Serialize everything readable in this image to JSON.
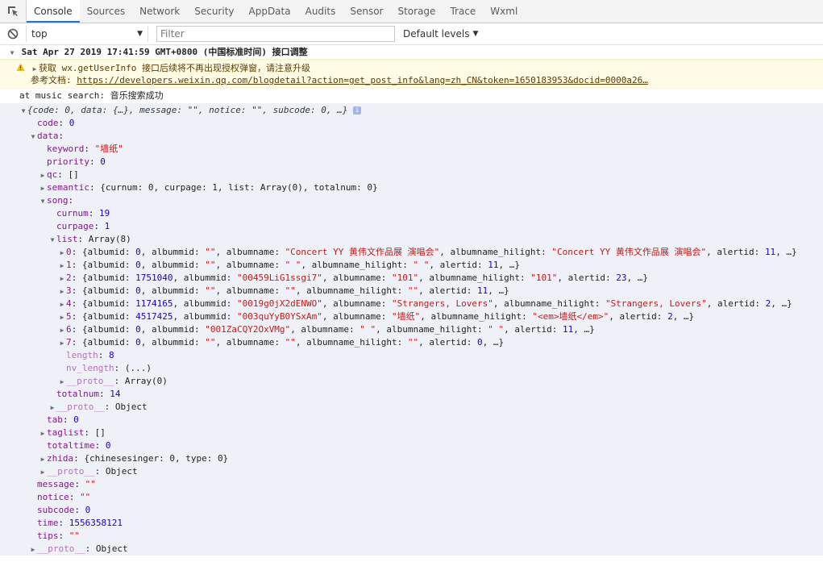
{
  "tabs": [
    {
      "label": "Console",
      "active": true
    },
    {
      "label": "Sources"
    },
    {
      "label": "Network"
    },
    {
      "label": "Security"
    },
    {
      "label": "AppData"
    },
    {
      "label": "Audits"
    },
    {
      "label": "Sensor"
    },
    {
      "label": "Storage"
    },
    {
      "label": "Trace"
    },
    {
      "label": "Wxml"
    }
  ],
  "toolbar": {
    "context": "top",
    "filter_placeholder": "Filter",
    "levels": "Default levels"
  },
  "group_header": "Sat Apr 27 2019 17:41:59 GMT+0800 (中国标准时间) 接口调整",
  "warning": {
    "prefix": "获取",
    "api": "wx.getUserInfo",
    "message": "接口后续将不再出现授权弹窗，请注意升级",
    "doc_label": "参考文档:",
    "doc_link": "https://developers.weixin.qq.com/blogdetail?action=get_post_info&lang=zh_CN&token=1650183953&docid=0000a26…"
  },
  "log_line": "at music search: 音乐搜索成功",
  "tree": {
    "summary": "{code: 0, data: {…}, message: \"\", notice: \"\", subcode: 0, …}",
    "code": "0",
    "data_label": "data",
    "keyword": "\"墙纸\"",
    "priority": "0",
    "qc": "[]",
    "semantic": "{curnum: 0, curpage: 1, list: Array(0), totalnum: 0}",
    "song_label": "song",
    "curnum": "19",
    "curpage": "1",
    "list_value": "Array(8)",
    "items": [
      {
        "idx": "0",
        "parts": [
          [
            "p",
            "{albumid: "
          ],
          [
            "n",
            "0"
          ],
          [
            "p",
            ", albummid: "
          ],
          [
            "s",
            "\"\""
          ],
          [
            "p",
            ", albumname: "
          ],
          [
            "s",
            "\"Concert YY 黄伟文作品展 演唱会\""
          ],
          [
            "p",
            ", albumname_hilight: "
          ],
          [
            "s",
            "\"Concert YY 黄伟文作品展 演唱会\""
          ],
          [
            "p",
            ", alertid: "
          ],
          [
            "n",
            "11"
          ],
          [
            "p",
            ", …}"
          ]
        ]
      },
      {
        "idx": "1",
        "parts": [
          [
            "p",
            "{albumid: "
          ],
          [
            "n",
            "0"
          ],
          [
            "p",
            ", albummid: "
          ],
          [
            "s",
            "\"\""
          ],
          [
            "p",
            ", albumname: "
          ],
          [
            "s",
            "\" \""
          ],
          [
            "p",
            ", albumname_hilight: "
          ],
          [
            "s",
            "\" \""
          ],
          [
            "p",
            ", alertid: "
          ],
          [
            "n",
            "11"
          ],
          [
            "p",
            ", …}"
          ]
        ]
      },
      {
        "idx": "2",
        "parts": [
          [
            "p",
            "{albumid: "
          ],
          [
            "n",
            "1751040"
          ],
          [
            "p",
            ", albummid: "
          ],
          [
            "s",
            "\"00459LiG1ssgi7\""
          ],
          [
            "p",
            ", albumname: "
          ],
          [
            "s",
            "\"101\""
          ],
          [
            "p",
            ", albumname_hilight: "
          ],
          [
            "s",
            "\"101\""
          ],
          [
            "p",
            ", alertid: "
          ],
          [
            "n",
            "23"
          ],
          [
            "p",
            ", …}"
          ]
        ]
      },
      {
        "idx": "3",
        "parts": [
          [
            "p",
            "{albumid: "
          ],
          [
            "n",
            "0"
          ],
          [
            "p",
            ", albummid: "
          ],
          [
            "s",
            "\"\""
          ],
          [
            "p",
            ", albumname: "
          ],
          [
            "s",
            "\"\""
          ],
          [
            "p",
            ", albumname_hilight: "
          ],
          [
            "s",
            "\"\""
          ],
          [
            "p",
            ", alertid: "
          ],
          [
            "n",
            "11"
          ],
          [
            "p",
            ", …}"
          ]
        ]
      },
      {
        "idx": "4",
        "parts": [
          [
            "p",
            "{albumid: "
          ],
          [
            "n",
            "1174165"
          ],
          [
            "p",
            ", albummid: "
          ],
          [
            "s",
            "\"0019g0jX2dENWO\""
          ],
          [
            "p",
            ", albumname: "
          ],
          [
            "s",
            "\"Strangers, Lovers\""
          ],
          [
            "p",
            ", albumname_hilight: "
          ],
          [
            "s",
            "\"Strangers, Lovers\""
          ],
          [
            "p",
            ", alertid: "
          ],
          [
            "n",
            "2"
          ],
          [
            "p",
            ", …}"
          ]
        ]
      },
      {
        "idx": "5",
        "parts": [
          [
            "p",
            "{albumid: "
          ],
          [
            "n",
            "4517425"
          ],
          [
            "p",
            ", albummid: "
          ],
          [
            "s",
            "\"003quYyB0YSxAm\""
          ],
          [
            "p",
            ", albumname: "
          ],
          [
            "s",
            "\"墙纸\""
          ],
          [
            "p",
            ", albumname_hilight: "
          ],
          [
            "s",
            "\"<em>墙纸</em>\""
          ],
          [
            "p",
            ", alertid: "
          ],
          [
            "n",
            "2"
          ],
          [
            "p",
            ", …}"
          ]
        ]
      },
      {
        "idx": "6",
        "parts": [
          [
            "p",
            "{albumid: "
          ],
          [
            "n",
            "0"
          ],
          [
            "p",
            ", albummid: "
          ],
          [
            "s",
            "\"001ZaCQY2OxVMg\""
          ],
          [
            "p",
            ", albumname: "
          ],
          [
            "s",
            "\"   \""
          ],
          [
            "p",
            ", albumname_hilight: "
          ],
          [
            "s",
            "\"   \""
          ],
          [
            "p",
            ", alertid: "
          ],
          [
            "n",
            "11"
          ],
          [
            "p",
            ", …}"
          ]
        ]
      },
      {
        "idx": "7",
        "parts": [
          [
            "p",
            "{albumid: "
          ],
          [
            "n",
            "0"
          ],
          [
            "p",
            ", albummid: "
          ],
          [
            "s",
            "\"\""
          ],
          [
            "p",
            ", albumname: "
          ],
          [
            "s",
            "\"\""
          ],
          [
            "p",
            ", albumname_hilight: "
          ],
          [
            "s",
            "\"\""
          ],
          [
            "p",
            ", alertid: "
          ],
          [
            "n",
            "0"
          ],
          [
            "p",
            ", …}"
          ]
        ]
      }
    ],
    "length": "8",
    "nv_length": "(...)",
    "list_proto": "Array(0)",
    "totalnum": "14",
    "song_proto": "Object",
    "tab": "0",
    "taglist": "[]",
    "totaltime": "0",
    "zhida": "{chinesesinger: 0, type: 0}",
    "data_proto": "Object",
    "message": "\"\"",
    "notice": "\"\"",
    "subcode": "0",
    "time": "1556358121",
    "tips": "\"\"",
    "root_proto": "Object"
  }
}
